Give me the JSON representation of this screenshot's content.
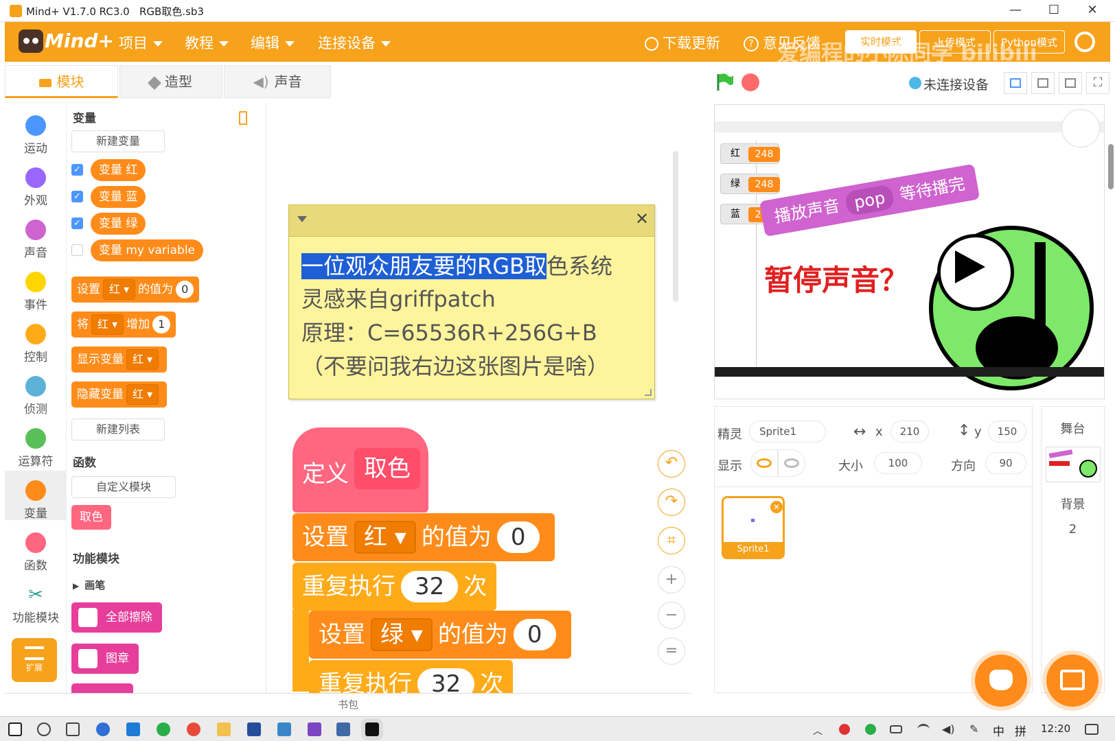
{
  "window": {
    "title": "Mind+ V1.7.0 RC3.0   RGB取色.sb3",
    "minimize": "—",
    "maximize": "☐",
    "close": "✕"
  },
  "menubar": {
    "logo": "Mind+",
    "items": [
      {
        "label": "项目"
      },
      {
        "label": "教程"
      },
      {
        "label": "编辑"
      },
      {
        "label": "连接设备"
      }
    ],
    "download": "下载更新",
    "feedback": "意见反馈",
    "mode_realtime": "实时模式",
    "mode_upload": "上传模式",
    "mode_python": "Python模式",
    "watermark": "爱编程的小陈同学 bilibili"
  },
  "tabs": [
    {
      "label": "模块"
    },
    {
      "label": "造型"
    },
    {
      "label": "声音"
    }
  ],
  "stage_header": {
    "status": "未连接设备"
  },
  "categories": [
    {
      "label": "运动",
      "color": "#4c97ff"
    },
    {
      "label": "外观",
      "color": "#9966ff"
    },
    {
      "label": "声音",
      "color": "#cf63cf"
    },
    {
      "label": "事件",
      "color": "#ffd500"
    },
    {
      "label": "控制",
      "color": "#ffab19"
    },
    {
      "label": "侦测",
      "color": "#5cb1d6"
    },
    {
      "label": "运算符",
      "color": "#59c059"
    },
    {
      "label": "变量",
      "color": "#ff8c1a"
    },
    {
      "label": "函数",
      "color": "#ff6680"
    },
    {
      "label": "功能模块",
      "color": "#2a9d8f"
    }
  ],
  "extension_label": "扩展",
  "palette": {
    "section_variables": "变量",
    "new_variable": "新建变量",
    "variables": [
      {
        "label": "变量 红",
        "checked": true
      },
      {
        "label": "变量 蓝",
        "checked": true
      },
      {
        "label": "变量 绿",
        "checked": true
      },
      {
        "label": "变量 my variable",
        "checked": false
      }
    ],
    "set_block": {
      "text1": "设置",
      "dropdown": "红",
      "text2": "的值为",
      "value": "0"
    },
    "change_block": {
      "text1": "将",
      "dropdown": "红",
      "text2": "增加",
      "value": "1"
    },
    "show_block": {
      "text1": "显示变量",
      "dropdown": "红"
    },
    "hide_block": {
      "text1": "隐藏变量",
      "dropdown": "红"
    },
    "new_list": "新建列表",
    "section_functions": "函数",
    "custom_block": "自定义模块",
    "func_block": "取色",
    "section_modules": "功能模块",
    "pen_group": "画笔",
    "pen_clear": "全部擦除",
    "pen_stamp": "图章"
  },
  "comment": {
    "line1_highlight": "一位观众朋友要的RGB取",
    "line1_rest": "色系统",
    "line2": "灵感来自griffpatch",
    "line3": "原理：C=65536R+256G+B",
    "line4": "（不要问我右边这张图片是啥）"
  },
  "script": {
    "define_label": "定义",
    "define_name": "取色",
    "set1": {
      "text1": "设置",
      "dropdown": "红",
      "text2": "的值为",
      "value": "0"
    },
    "repeat1": {
      "text1": "重复执行",
      "value": "32",
      "text2": "次"
    },
    "set2": {
      "text1": "设置",
      "dropdown": "绿",
      "text2": "的值为",
      "value": "0"
    },
    "repeat2": {
      "text1": "重复执行",
      "value": "32",
      "text2": "次"
    }
  },
  "stage": {
    "monitors": [
      {
        "label": "红",
        "value": "248"
      },
      {
        "label": "绿",
        "value": "248"
      },
      {
        "label": "蓝",
        "value": "240"
      }
    ],
    "image_block_text1": "播放声音",
    "image_block_dropdown": "pop",
    "image_block_text2": "等待播完",
    "image_caption": "暂停声音？"
  },
  "sprite_info": {
    "sprite_label": "精灵",
    "sprite_name": "Sprite1",
    "x_label": "x",
    "x": "210",
    "y_label": "y",
    "y": "150",
    "show_label": "显示",
    "size_label": "大小",
    "size": "100",
    "direction_label": "方向",
    "direction": "90",
    "thumb_name": "Sprite1"
  },
  "stage_panel": {
    "title": "舞台",
    "backdrop_label": "背景",
    "backdrop_count": "2"
  },
  "backpack": "书包",
  "taskbar": {
    "ime": "中",
    "layout": "拼",
    "time": "12:20"
  },
  "colors": {
    "accent": "#f7a21b",
    "variables": "#ff8c1a",
    "functions": "#ff6680",
    "pen": "#e63e9a",
    "comment": "#fef49c"
  }
}
